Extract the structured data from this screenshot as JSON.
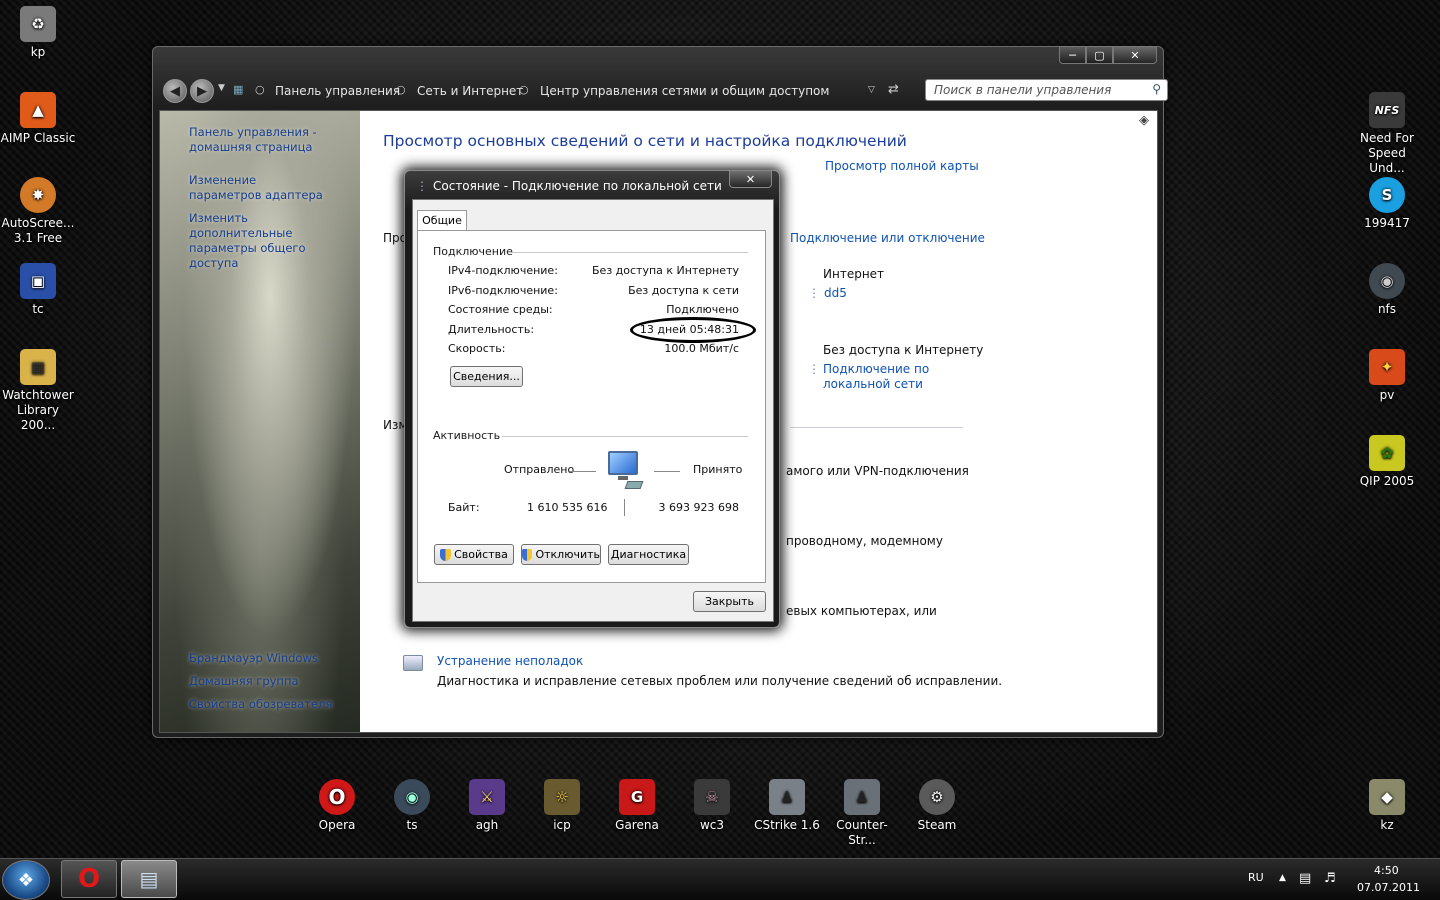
{
  "desktop_left": [
    {
      "label": "kp",
      "icon": "kp-icon",
      "color": "#7a7a7a"
    },
    {
      "label": "AIMP Classic",
      "icon": "aimp-icon",
      "color": "#e05a1a"
    },
    {
      "label": "AutoScree... 3.1 Free",
      "icon": "film-reel-icon",
      "color": "#d27a28"
    },
    {
      "label": "tc",
      "icon": "floppy-disk-icon",
      "color": "#2a4fa8"
    },
    {
      "label": "Watchtower Library 200...",
      "icon": "watchtower-icon",
      "color": "#d9b24a"
    }
  ],
  "desktop_right": [
    {
      "label": "Need For Speed Und...",
      "icon": "nfs-icon",
      "color": "#3a3a3a"
    },
    {
      "label": "199417",
      "icon": "skype-icon",
      "color": "#1aa0e0"
    },
    {
      "label": "nfs",
      "icon": "nfs-disc-icon",
      "color": "#404850"
    },
    {
      "label": "pv",
      "icon": "pv-icon",
      "color": "#d84a1a"
    },
    {
      "label": "QIP 2005",
      "icon": "qip-icon",
      "color": "#c8c820"
    },
    {
      "label": "kz",
      "icon": "kz-icon",
      "color": "#8a8a6a"
    }
  ],
  "desktop_bottom": [
    {
      "label": "Opera",
      "icon": "opera-icon",
      "color": "#d01818"
    },
    {
      "label": "ts",
      "icon": "teamspeak-icon",
      "color": "#3a4a5a"
    },
    {
      "label": "agh",
      "icon": "agh-icon",
      "color": "#5a3a8a"
    },
    {
      "label": "icp",
      "icon": "icp-icon",
      "color": "#6a5a30"
    },
    {
      "label": "Garena",
      "icon": "garena-icon",
      "color": "#c81818"
    },
    {
      "label": "wc3",
      "icon": "warcraft3-icon",
      "color": "#3a3a3a"
    },
    {
      "label": "CStrike 1.6",
      "icon": "cstrike-icon",
      "color": "#7a8088"
    },
    {
      "label": "Counter-Str...",
      "icon": "counter-strike-icon",
      "color": "#6a7078"
    },
    {
      "label": "Steam",
      "icon": "steam-icon",
      "color": "#5a5a5a"
    }
  ],
  "window": {
    "breadcrumb": [
      "Панель управления",
      "Сеть и Интернет",
      "Центр управления сетями и общим доступом"
    ],
    "search_placeholder": "Поиск в панели управления",
    "sidebar_links": [
      "Панель управления - домашняя страница",
      "Изменение параметров адаптера",
      "Изменить дополнительные параметры общего доступа"
    ],
    "sidebar_bottom_links": [
      "Брандмауэр Windows",
      "Домашняя группа",
      "Свойства обозревателя"
    ],
    "main_title": "Просмотр основных сведений о сети и настройка подключений",
    "full_map_link": "Просмотр полной карты",
    "connect_link": "Подключение или отключение",
    "prefix_1": "Про",
    "prefix_2": "Изм",
    "internet_label": "Интернет",
    "dd5_link": "dd5",
    "no_internet_label": "Без доступа к Интернету",
    "lan_link": "Подключение по локальной сети",
    "vpn_fragment": "амого или VPN-подключения",
    "wired_fragment": "проводному, модемному",
    "computers_fragment": "евых компьютерах, или",
    "troubleshoot_link": "Устранение неполадок",
    "troubleshoot_desc": "Диагностика и исправление сетевых проблем или получение сведений об исправлении."
  },
  "dialog": {
    "title": "Состояние - Подключение по локальной сети",
    "tab": "Общие",
    "connection_group": "Подключение",
    "rows": [
      {
        "label": "IPv4-подключение:",
        "value": "Без доступа к Интернету"
      },
      {
        "label": "IPv6-подключение:",
        "value": "Без доступа к сети"
      },
      {
        "label": "Состояние среды:",
        "value": "Подключено"
      },
      {
        "label": "Длительность:",
        "value": "13 дней 05:48:31"
      },
      {
        "label": "Скорость:",
        "value": "100.0 Мбит/с"
      }
    ],
    "details_button": "Сведения...",
    "activity_group": "Активность",
    "sent_label": "Отправлено",
    "received_label": "Принято",
    "bytes_label": "Байт:",
    "bytes_sent": "1 610 535 616",
    "bytes_received": "3 693 923 698",
    "properties_button": "Свойства",
    "disable_button": "Отключить",
    "diagnose_button": "Диагностика",
    "close_button": "Закрыть"
  },
  "taskbar": {
    "language": "RU",
    "time": "4:50",
    "date": "07.07.2011"
  }
}
